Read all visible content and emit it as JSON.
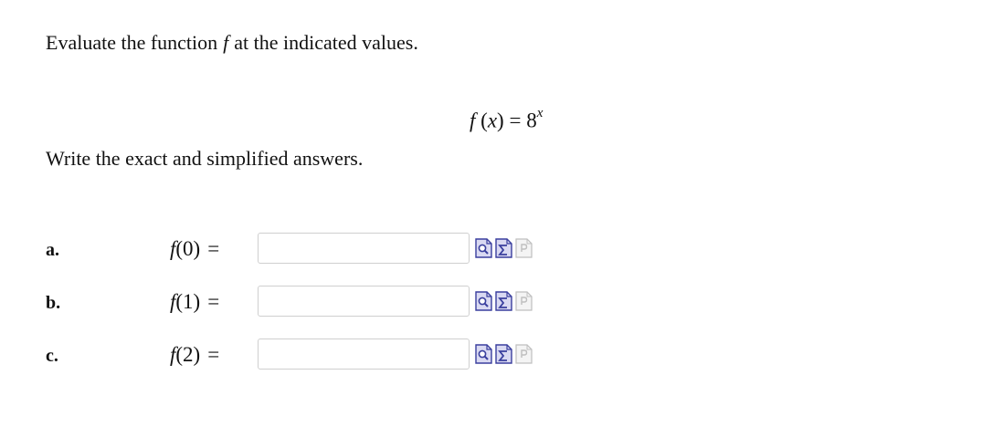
{
  "question": {
    "instruction": {
      "prefix": "Evaluate the function",
      "var": "f",
      "suffix": "at the indicated values."
    },
    "equation": {
      "lhs_func": "f",
      "lhs_open": " (",
      "lhs_var": "x",
      "lhs_close": ")",
      "equals": " = ",
      "base": "8",
      "exponent": "x"
    },
    "answer_instruction": "Write the exact and simplified answers."
  },
  "parts": [
    {
      "label": "a.",
      "func": "f",
      "arg": "(0)",
      "equals": "=",
      "value": "",
      "placeholder": ""
    },
    {
      "label": "b.",
      "func": "f",
      "arg": "(1)",
      "equals": "=",
      "value": "",
      "placeholder": ""
    },
    {
      "label": "c.",
      "func": "f",
      "arg": "(2)",
      "equals": "=",
      "value": "",
      "placeholder": ""
    }
  ],
  "tools": [
    {
      "name": "preview-icon"
    },
    {
      "name": "equation-editor-icon"
    },
    {
      "name": "help-document-icon"
    }
  ],
  "colors": {
    "icon_blue": "#3a3f9e",
    "icon_fill": "#d9d9f2",
    "icon_disabled": "#bfbfbf"
  }
}
